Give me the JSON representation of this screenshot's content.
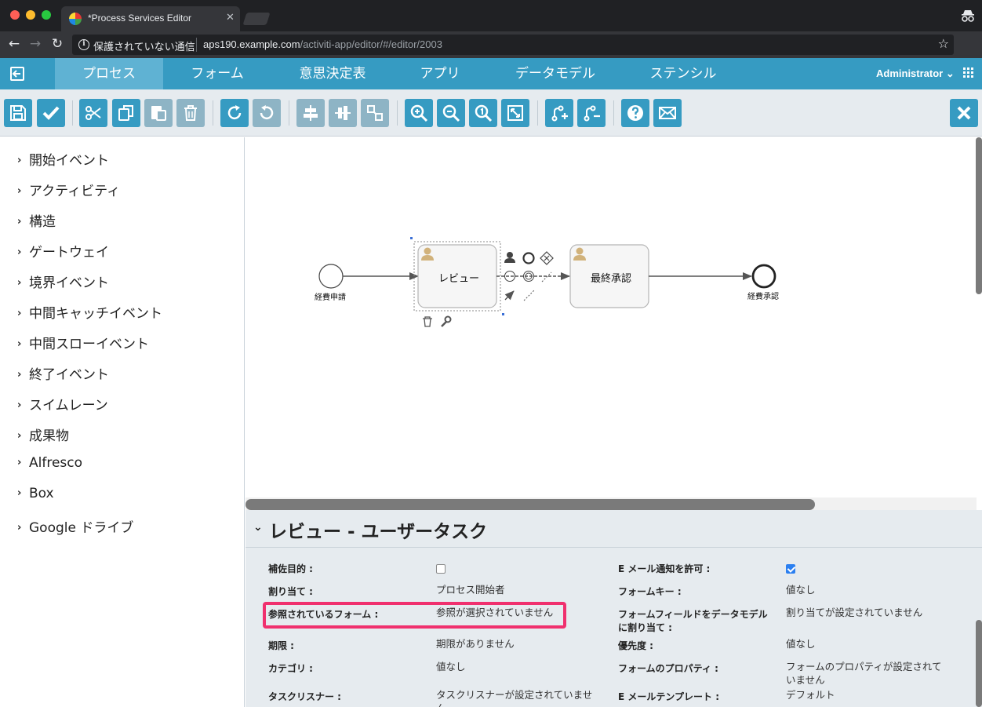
{
  "browser": {
    "tab_title": "*Process Services Editor",
    "tab_close": "✕",
    "security_label": "保護されていない通信",
    "url_host": "aps190.example.com",
    "url_path": "/activiti-app/editor/#/editor/2003",
    "back": "←",
    "forward": "→",
    "reload": "↻",
    "star": "☆",
    "menu": "⋮"
  },
  "appnav": {
    "tabs": [
      {
        "label": "プロセス",
        "active": true
      },
      {
        "label": "フォーム"
      },
      {
        "label": "意思決定表"
      },
      {
        "label": "アプリ"
      },
      {
        "label": "データモデル"
      },
      {
        "label": "ステンシル"
      }
    ],
    "user": "Administrator",
    "user_caret": "⌄"
  },
  "toolbar": {
    "buttons": [
      "save-icon",
      "validate-icon",
      "cut-icon",
      "copy-icon",
      "paste-icon",
      "delete-icon",
      "redo-icon",
      "undo-icon",
      "align-horizontal-icon",
      "align-vertical-icon",
      "same-size-icon",
      "zoom-in-icon",
      "zoom-out-icon",
      "zoom-actual-icon",
      "zoom-fit-icon",
      "add-bendpoint-icon",
      "remove-bendpoint-icon",
      "help-icon",
      "feedback-mail-icon",
      "close-icon"
    ]
  },
  "palette": {
    "chevron": "›",
    "items": [
      "開始イベント",
      "アクティビティ",
      "構造",
      "ゲートウェイ",
      "境界イベント",
      "中間キャッチイベント",
      "中間スローイベント",
      "終了イベント",
      "スイムレーン",
      "成果物",
      "Alfresco",
      "Box",
      "Google ドライブ"
    ]
  },
  "diagram": {
    "start_event": "経費申請",
    "task_review": "レビュー",
    "task_final": "最終承認",
    "end_event": "経費承認"
  },
  "properties": {
    "title": "レビュー - ユーザータスク",
    "chevron": "⌄",
    "rows": [
      {
        "l1": "補佐目的 :",
        "v1_checkbox": false,
        "l2": "E メール通知を許可 :",
        "v2_checkbox": true
      },
      {
        "l1": "割り当て :",
        "v1": "プロセス開始者",
        "l2": "フォームキー :",
        "v2": "値なし"
      },
      {
        "l1": "参照されているフォーム :",
        "v1": "参照が選択されていません",
        "l2": "フォームフィールドをデータモデルに割り当て :",
        "v2": "割り当てが設定されていません"
      },
      {
        "l1": "期限 :",
        "v1": "期限がありません",
        "l2": "優先度 :",
        "v2": "値なし"
      },
      {
        "l1": "カテゴリ :",
        "v1": "値なし",
        "l2": "フォームのプロパティ :",
        "v2": "フォームのプロパティが設定されていません"
      },
      {
        "l1": "タスクリスナー :",
        "v1": "タスクリスナーが設定されていません",
        "l2": "E メールテンプレート :",
        "v2": "デフォルト"
      }
    ]
  },
  "colors": {
    "accent": "#369bc2",
    "active_tab": "#5fb2d3",
    "highlight": "#f0306e"
  }
}
